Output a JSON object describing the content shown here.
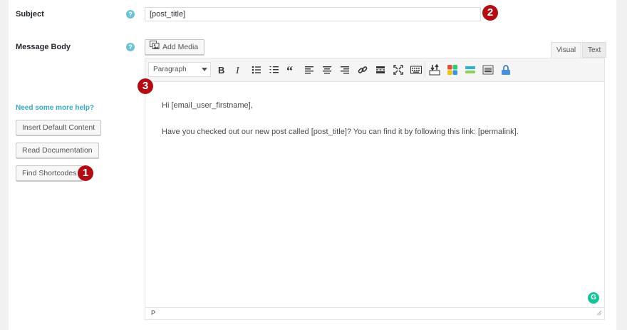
{
  "form": {
    "subject_label": "Subject",
    "message_body_label": "Message Body",
    "subject_value": "[post_title]",
    "help_glyph": "?"
  },
  "sidebar": {
    "help_link": "Need some more help?",
    "buttons": [
      "Insert Default Content",
      "Read Documentation",
      "Find Shortcodes"
    ]
  },
  "editor": {
    "add_media_label": "Add Media",
    "tabs": [
      "Visual",
      "Text"
    ],
    "format_select_value": "Paragraph",
    "content_lines": [
      "Hi [email_user_firstname],",
      "Have you checked out our new post called [post_title]? You can find it by following this link: [permalink]."
    ],
    "status_path": "P",
    "grammarly_glyph": "G"
  },
  "annotations": [
    "1",
    "2",
    "3"
  ],
  "colors": {
    "badge": "#b20d14",
    "help_icon": "#6bc3d5",
    "help_link": "#34a9c4",
    "grammarly": "#15c39a"
  }
}
